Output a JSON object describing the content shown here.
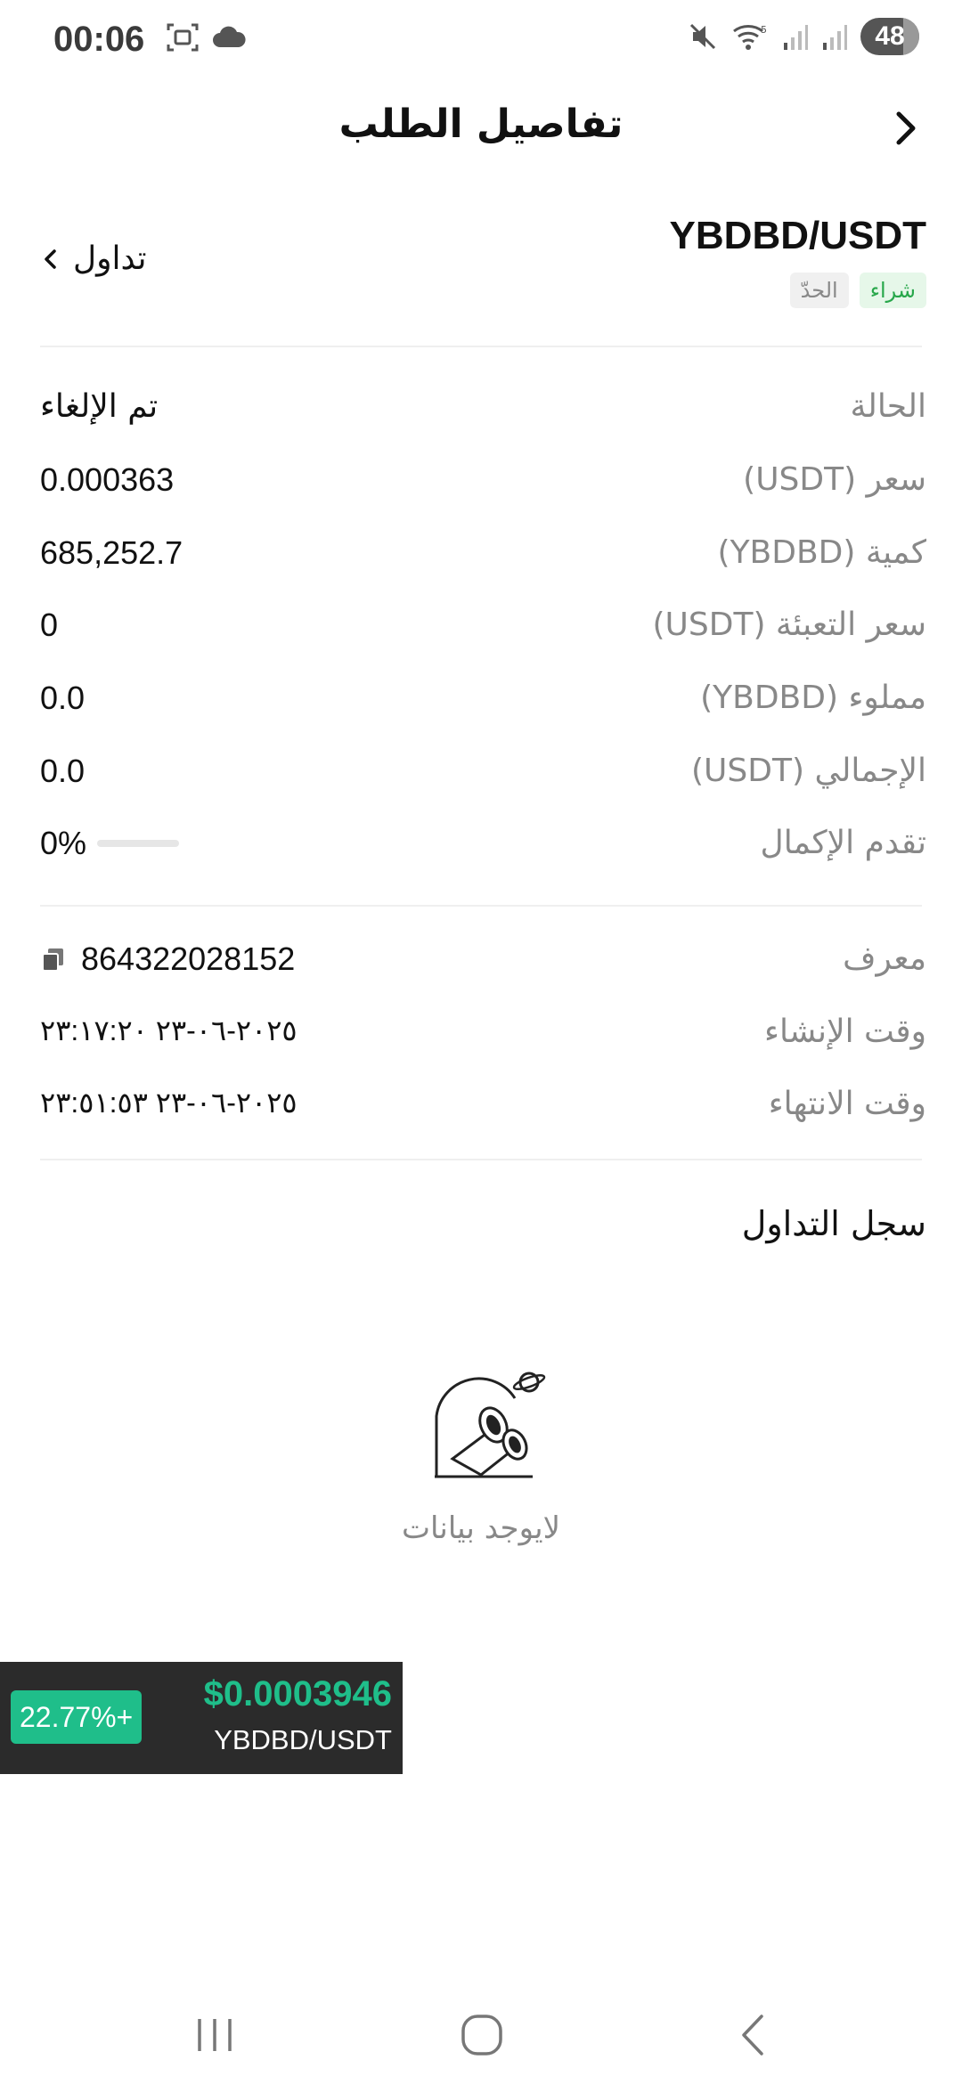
{
  "status_bar": {
    "time": "00:06",
    "battery": "48",
    "icons": [
      "screenshot-icon",
      "cloud-icon",
      "mute-icon",
      "wifi-icon",
      "signal-icon",
      "signal-icon"
    ]
  },
  "header": {
    "title": "تفاصيل الطلب"
  },
  "order": {
    "pair": "YBDBD/USDT",
    "tag_buy": "شراء",
    "tag_limit": "الحدّ",
    "trade_link": "تداول"
  },
  "details": [
    {
      "label": "الحالة",
      "value": "تم الإلغاء"
    },
    {
      "label": "سعر (USDT)",
      "value": "0.000363"
    },
    {
      "label": "كمية (YBDBD)",
      "value": "685,252.7"
    },
    {
      "label": "سعر التعبئة (USDT)",
      "value": "0"
    },
    {
      "label": "مملوء (YBDBD)",
      "value": "0.0"
    },
    {
      "label": "الإجمالي (USDT)",
      "value": "0.0"
    }
  ],
  "progress": {
    "label": "تقدم الإكمال",
    "value": "0%",
    "fraction": 0
  },
  "meta": [
    {
      "label": "معرف",
      "value": "864322028152"
    },
    {
      "label": "وقت الإنشاء",
      "value": "٢٠٢٥-٠٦-٢٣ ٢٣:١٧:٢٠"
    },
    {
      "label": "وقت الانتهاء",
      "value": "٢٠٢٥-٠٦-٢٣ ٢٣:٥١:٥٣"
    }
  ],
  "trade_history": {
    "title": "سجل التداول",
    "empty_text": "لايوجد بيانات"
  },
  "ticker": {
    "change": "22.77%+",
    "price": "$0.0003946",
    "pair": "YBDBD/USDT",
    "accent_color": "#1fbe8a"
  }
}
